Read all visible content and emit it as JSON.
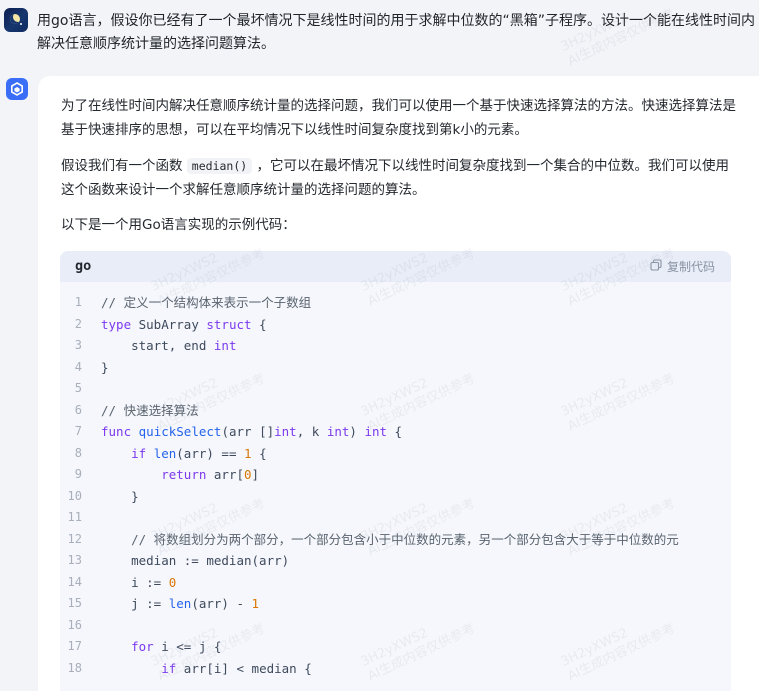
{
  "user": {
    "message": "用go语言，假设你已经有了一个最坏情况下是线性时间的用于求解中位数的“黑箱”子程序。设计一个能在线性时间内解决任意顺序统计量的选择问题算法。"
  },
  "assistant": {
    "para1": "为了在线性时间内解决任意顺序统计量的选择问题，我们可以使用一个基于快速选择算法的方法。快速选择算法是基于快速排序的思想，可以在平均情况下以线性时间复杂度找到第k小的元素。",
    "para2_before": "假设我们有一个函数 ",
    "para2_code": "median()",
    "para2_after": " ，它可以在最坏情况下以线性时间复杂度找到一个集合的中位数。我们可以使用这个函数来设计一个求解任意顺序统计量的选择问题的算法。",
    "para3": "以下是一个用Go语言实现的示例代码："
  },
  "code": {
    "language": "go",
    "copy_label": "复制代码",
    "lines": [
      {
        "n": "1",
        "text": "// 定义一个结构体来表示一个子数组"
      },
      {
        "n": "2",
        "text": "type SubArray struct {"
      },
      {
        "n": "3",
        "text": "    start, end int"
      },
      {
        "n": "4",
        "text": "}"
      },
      {
        "n": "5",
        "text": ""
      },
      {
        "n": "6",
        "text": "// 快速选择算法"
      },
      {
        "n": "7",
        "text": "func quickSelect(arr []int, k int) int {"
      },
      {
        "n": "8",
        "text": "    if len(arr) == 1 {"
      },
      {
        "n": "9",
        "text": "        return arr[0]"
      },
      {
        "n": "10",
        "text": "    }"
      },
      {
        "n": "11",
        "text": ""
      },
      {
        "n": "12",
        "text": "    // 将数组划分为两个部分，一个部分包含小于中位数的元素，另一个部分包含大于等于中位数的元"
      },
      {
        "n": "13",
        "text": "    median := median(arr)"
      },
      {
        "n": "14",
        "text": "    i := 0"
      },
      {
        "n": "15",
        "text": "    j := len(arr) - 1"
      },
      {
        "n": "16",
        "text": ""
      },
      {
        "n": "17",
        "text": "    for i <= j {"
      },
      {
        "n": "18",
        "text": "        if arr[i] < median {"
      }
    ]
  },
  "watermark": {
    "line1": "3H2yXWS2",
    "line2": "AI生成内容仅供参考"
  },
  "colors": {
    "page_bg": "#f3f4f8",
    "card_bg": "#ffffff",
    "code_bg": "#f5f7fc",
    "code_header_bg": "#e8edf8",
    "ai_icon": "#3a6ef6",
    "keyword": "#7c3aed",
    "func_name": "#2563eb",
    "number": "#d97706",
    "comment": "#59636e"
  }
}
